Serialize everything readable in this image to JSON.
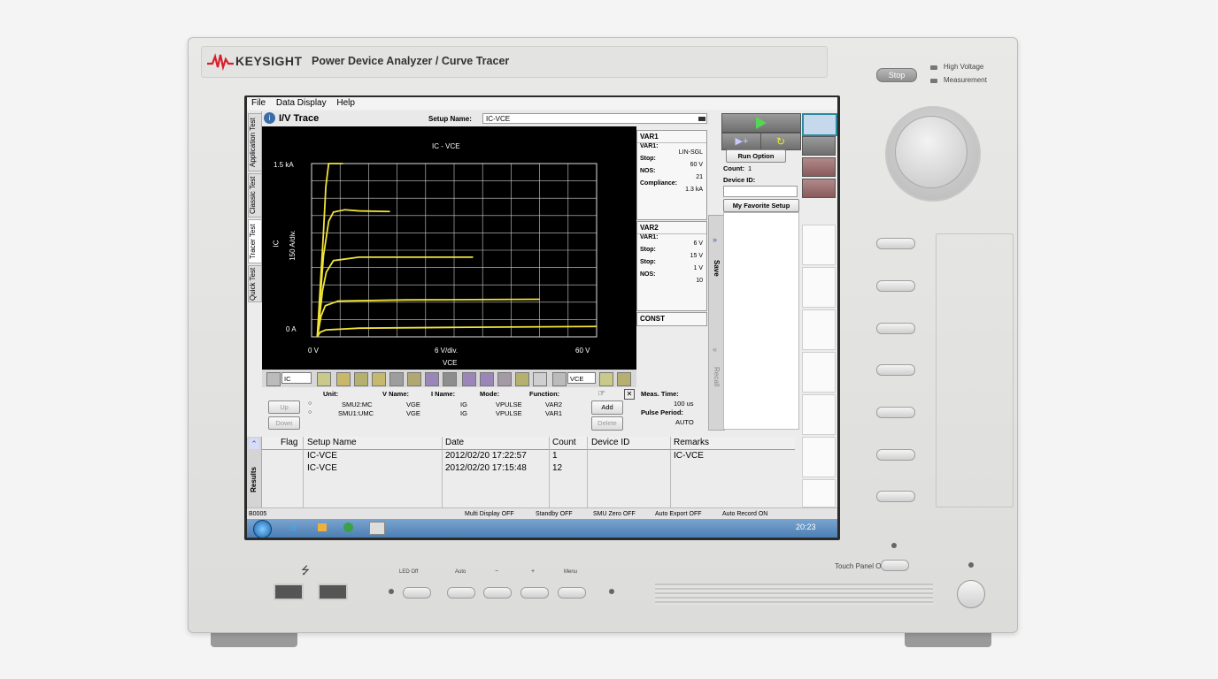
{
  "brand": {
    "name": "KEYSIGHT",
    "model": "Power Device Analyzer / Curve Tracer"
  },
  "front_panel": {
    "stop_label": "Stop",
    "high_voltage": "High Voltage",
    "measurement": "Measurement",
    "touch_panel": "Touch Panel Off",
    "usb_symbol": "⭍",
    "keys": [
      "LED Off",
      "Auto",
      "−",
      "+",
      "Menu"
    ]
  },
  "menu": [
    "File",
    "Data Display",
    "Help"
  ],
  "left_tabs": [
    "Application Test",
    "Classic Test",
    "Tracer Test",
    "Quick Test"
  ],
  "header": {
    "title": "I/V Trace",
    "setup_label": "Setup Name:",
    "setup_value": "IC-VCE"
  },
  "plot": {
    "title": "IC - VCE",
    "y_top": "1.5 kA",
    "y_bottom": "0 A",
    "y_label": "IC",
    "y_div": "150 A/div.",
    "x_left": "0 V",
    "x_right": "60 V",
    "x_div": "6 V/div.",
    "x_label": "VCE",
    "combo_left": "IC",
    "combo_right": "VCE"
  },
  "chart_data": {
    "type": "line",
    "title": "IC - VCE",
    "xlabel": "VCE",
    "ylabel": "IC",
    "xlim": [
      0,
      60
    ],
    "ylim": [
      0,
      1500
    ],
    "grid": true,
    "series": [
      {
        "x": [
          1.2,
          2.5,
          3,
          3.6,
          4.6,
          5.6,
          6.6
        ],
        "values": [
          0,
          900,
          1300,
          1500,
          1500,
          1500,
          1500
        ]
      },
      {
        "x": [
          1.2,
          2.5,
          3.6,
          4.6,
          7,
          10,
          16.5
        ],
        "values": [
          0,
          700,
          1000,
          1080,
          1100,
          1090,
          1085
        ]
      },
      {
        "x": [
          1.2,
          2.3,
          3.1,
          4.6,
          10,
          30,
          34
        ],
        "values": [
          0,
          400,
          560,
          660,
          690,
          690,
          690
        ]
      },
      {
        "x": [
          1.2,
          2,
          2.9,
          5.6,
          20,
          48
        ],
        "values": [
          0,
          180,
          270,
          310,
          320,
          325
        ]
      },
      {
        "x": [
          1.2,
          1.8,
          3,
          10,
          30,
          60
        ],
        "values": [
          0,
          40,
          60,
          75,
          82,
          90
        ]
      }
    ]
  },
  "var1": {
    "title": "VAR1",
    "varp_label": "VAR1:",
    "mode": "LIN-SGL",
    "stop_label": "Stop:",
    "stop_value": "60 V",
    "nos_label": "NOS:",
    "nos_value": "21",
    "compliance_label": "Compliance:",
    "compliance_value": "1.3 kA"
  },
  "var2": {
    "title": "VAR2",
    "varp_label": "VAR1:",
    "start_label": "Stop:",
    "start_value": "6 V",
    "stop_label": "Stop:",
    "stop_value": "15 V",
    "step_label": "Stop:",
    "step_value": "1 V",
    "nos_label": "NOS:",
    "nos_value": "10"
  },
  "const": {
    "title": "CONST"
  },
  "smu_table": {
    "headers": [
      "Unit:",
      "V Name:",
      "I Name:",
      "Mode:",
      "Function:"
    ],
    "rows": [
      [
        "SMU2:MC",
        "VGE",
        "IG",
        "VPULSE",
        "VAR2"
      ],
      [
        "SMU1:UMC",
        "VGE",
        "IG",
        "VPULSE",
        "VAR1"
      ]
    ],
    "up": "Up",
    "down": "Down",
    "add": "Add",
    "delete": "Delete"
  },
  "timing": {
    "meas_label": "Meas. Time:",
    "meas_value": "100 us",
    "pulse_label": "Pulse Period:",
    "pulse_value": "AUTO"
  },
  "run_panel": {
    "run_option": "Run Option",
    "count_label": "Count:",
    "count_value": "1",
    "device_label": "Device ID:",
    "favorite": "My Favorite Setup"
  },
  "side_tabs": {
    "save": "Save",
    "recall": "Recall",
    "results": "Results"
  },
  "results": {
    "headers": [
      "Flag",
      "Setup Name",
      "Date",
      "Count",
      "Device ID",
      "Remarks"
    ],
    "rows": [
      [
        "",
        "IC-VCE",
        "2012/02/20 17:22:57",
        "1",
        "",
        "IC-VCE"
      ],
      [
        "",
        "IC-VCE",
        "2012/02/20 17:15:48",
        "12",
        "",
        ""
      ]
    ]
  },
  "status": {
    "left": "B0005",
    "items": [
      "Multi Display OFF",
      "Standby OFF",
      "SMU Zero OFF",
      "Auto Export OFF",
      "Auto Record ON"
    ]
  },
  "taskbar": {
    "time": "20:23"
  },
  "colors": {
    "trace": "#f0e43a",
    "plot_bg": "#000000",
    "accent": "#3a6ea8"
  }
}
